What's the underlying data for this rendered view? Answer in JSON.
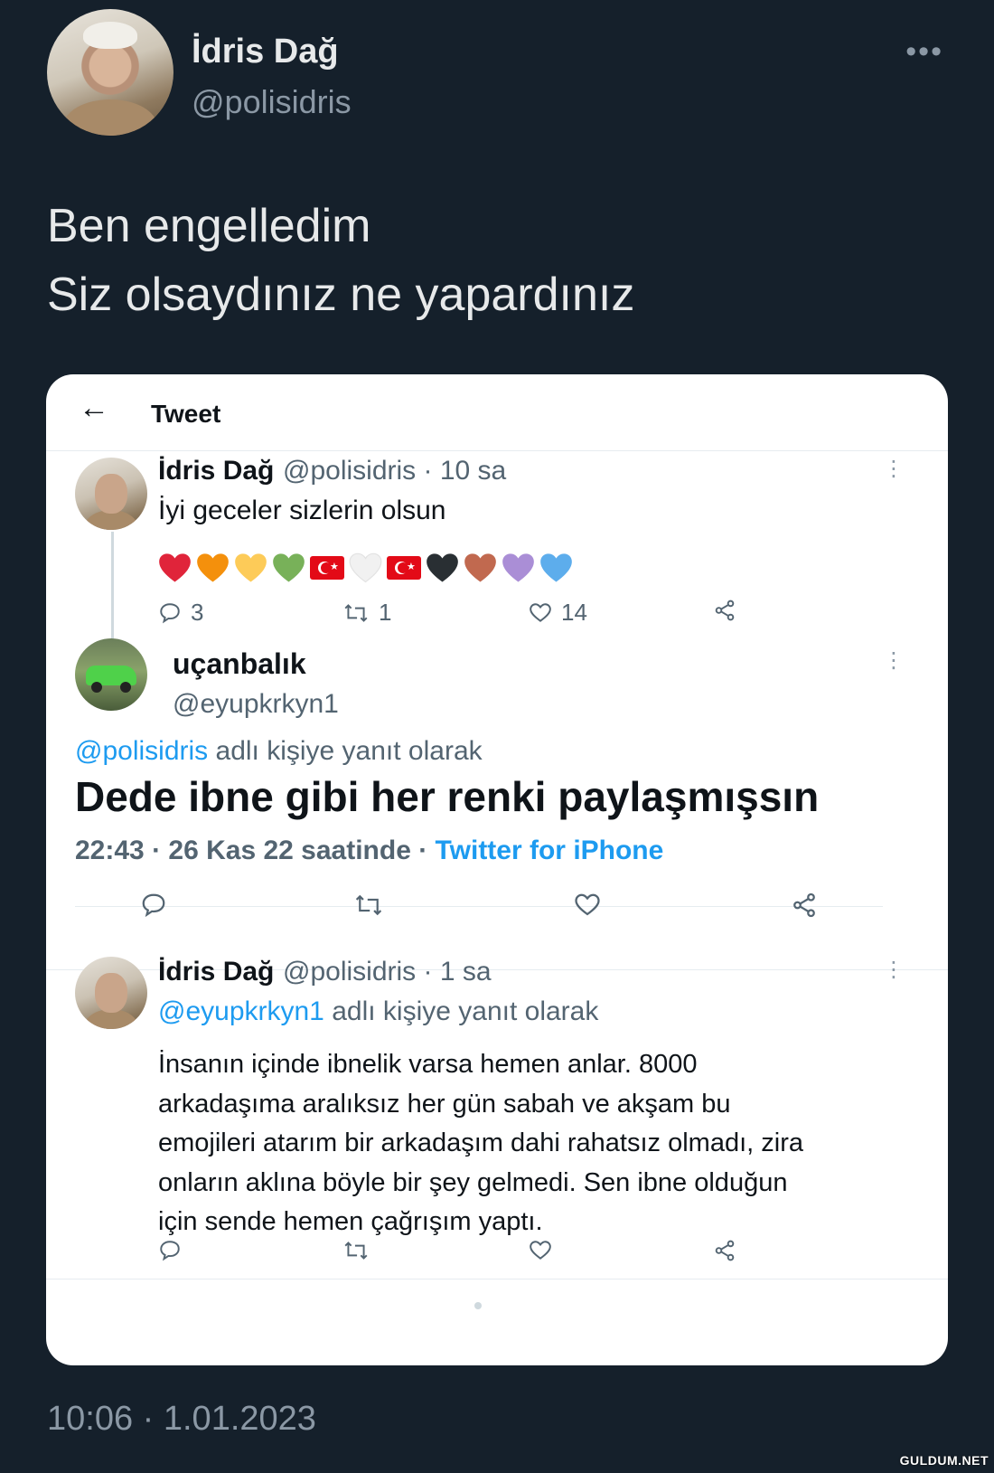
{
  "outer_tweet": {
    "name": "İdris Dağ",
    "handle": "@polisidris",
    "more": "•••",
    "text_lines": [
      "Ben engelledim",
      "Siz olsaydınız ne yapardınız"
    ],
    "timestamp": "10:06 · 1.01.2023"
  },
  "card": {
    "topbar": {
      "back": "←",
      "title": "Tweet"
    },
    "tweet1": {
      "name": "İdris Dağ",
      "meta": "@polisidris · 10 sa",
      "text": "İyi geceler sizlerin olsun",
      "hearts": [
        "red",
        "orange",
        "yellow",
        "green",
        "flag",
        "white",
        "flag",
        "black",
        "brown",
        "purple",
        "blue"
      ],
      "replies": "3",
      "retweets": "1",
      "likes": "14"
    },
    "tweet2": {
      "name": "uçanbalık",
      "handle": "@eyupkrkyn1",
      "reply_to_handle": "@polisidris",
      "reply_to_suffix": " adlı kişiye yanıt olarak",
      "text": "Dede ibne gibi her renki paylaşmışsın",
      "time": "22:43 · 26 Kas 22 saatinde · ",
      "source": "Twitter for iPhone"
    },
    "tweet3": {
      "name": "İdris Dağ",
      "meta": "@polisidris · 1 sa",
      "reply_to_handle": "@eyupkrkyn1",
      "reply_to_suffix": " adlı kişiye yanıt olarak",
      "text_lines": [
        "İnsanın içinde ibnelik varsa hemen anlar. 8000",
        "arkadaşıma aralıksız her gün sabah ve akşam bu",
        "emojileri atarım bir arkadaşım dahi rahatsız olmadı, zira",
        "onların aklına böyle bir şey gelmedi. Sen ibne olduğun",
        "için sende hemen çağrışım yaptı."
      ]
    }
  },
  "watermark": "GULDUM.NET",
  "colors": {
    "background": "#15202b",
    "link": "#1d9bf0",
    "secondary": "#536471"
  }
}
